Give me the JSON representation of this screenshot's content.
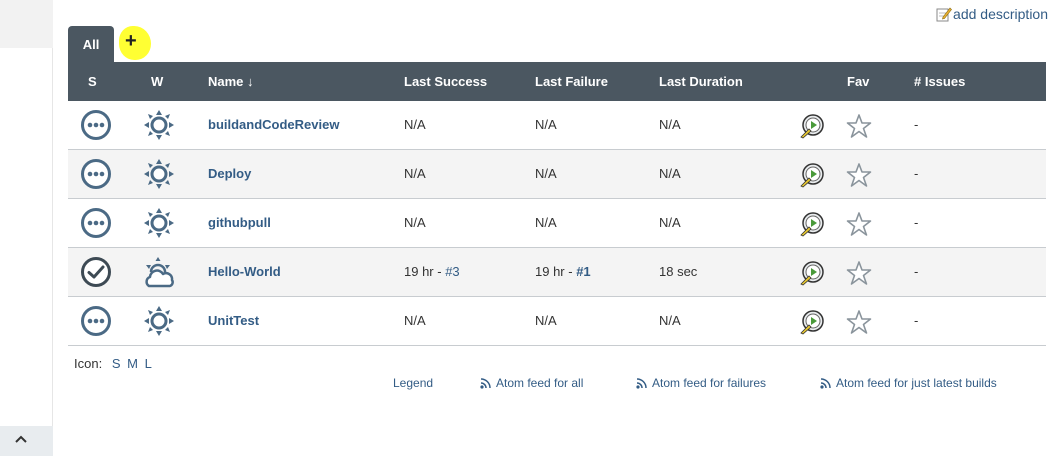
{
  "header": {
    "add_description_label": "add description"
  },
  "tabs": [
    {
      "label": "All",
      "active": true
    },
    {
      "label": "+",
      "highlighted": true,
      "highlight_color": "#ffff33"
    }
  ],
  "table": {
    "columns": [
      "S",
      "W",
      "Name ↓",
      "Last Success",
      "Last Failure",
      "Last Duration",
      "Fav",
      "# Issues"
    ],
    "rows": [
      {
        "status_icon": "pending-circle-icon",
        "weather_icon": "sun-weather-icon",
        "name": "buildandCodeReview",
        "last_success": "N/A",
        "last_failure": "N/A",
        "last_duration": "N/A",
        "issues": "-"
      },
      {
        "status_icon": "pending-circle-icon",
        "weather_icon": "sun-weather-icon",
        "name": "Deploy",
        "last_success": "N/A",
        "last_failure": "N/A",
        "last_duration": "N/A",
        "issues": "-"
      },
      {
        "status_icon": "pending-circle-icon",
        "weather_icon": "sun-weather-icon",
        "name": "githubpull",
        "last_success": "N/A",
        "last_failure": "N/A",
        "last_duration": "N/A",
        "issues": "-"
      },
      {
        "status_icon": "check-circle-icon",
        "weather_icon": "partly-cloudy-weather-icon",
        "name": "Hello-World",
        "last_success_time": "19 hr - ",
        "last_success_build": "#3",
        "last_failure_time": "19 hr - ",
        "last_failure_build": "#1",
        "last_duration": "18 sec",
        "issues": "-"
      },
      {
        "status_icon": "pending-circle-icon",
        "weather_icon": "sun-weather-icon",
        "name": "UnitTest",
        "last_success": "N/A",
        "last_failure": "N/A",
        "last_duration": "N/A",
        "issues": "-"
      }
    ]
  },
  "icon_size": {
    "label": "Icon:",
    "options": [
      "S",
      "M",
      "L"
    ]
  },
  "footer": {
    "legend": "Legend",
    "feed_all": "Atom feed for all",
    "feed_failures": "Atom feed for failures",
    "feed_latest": "Atom feed for just latest builds"
  },
  "colors": {
    "header_bg": "#4b5761",
    "link": "#335c85",
    "icon": "#4b6a85",
    "alt_row": "#f4f4f4"
  }
}
